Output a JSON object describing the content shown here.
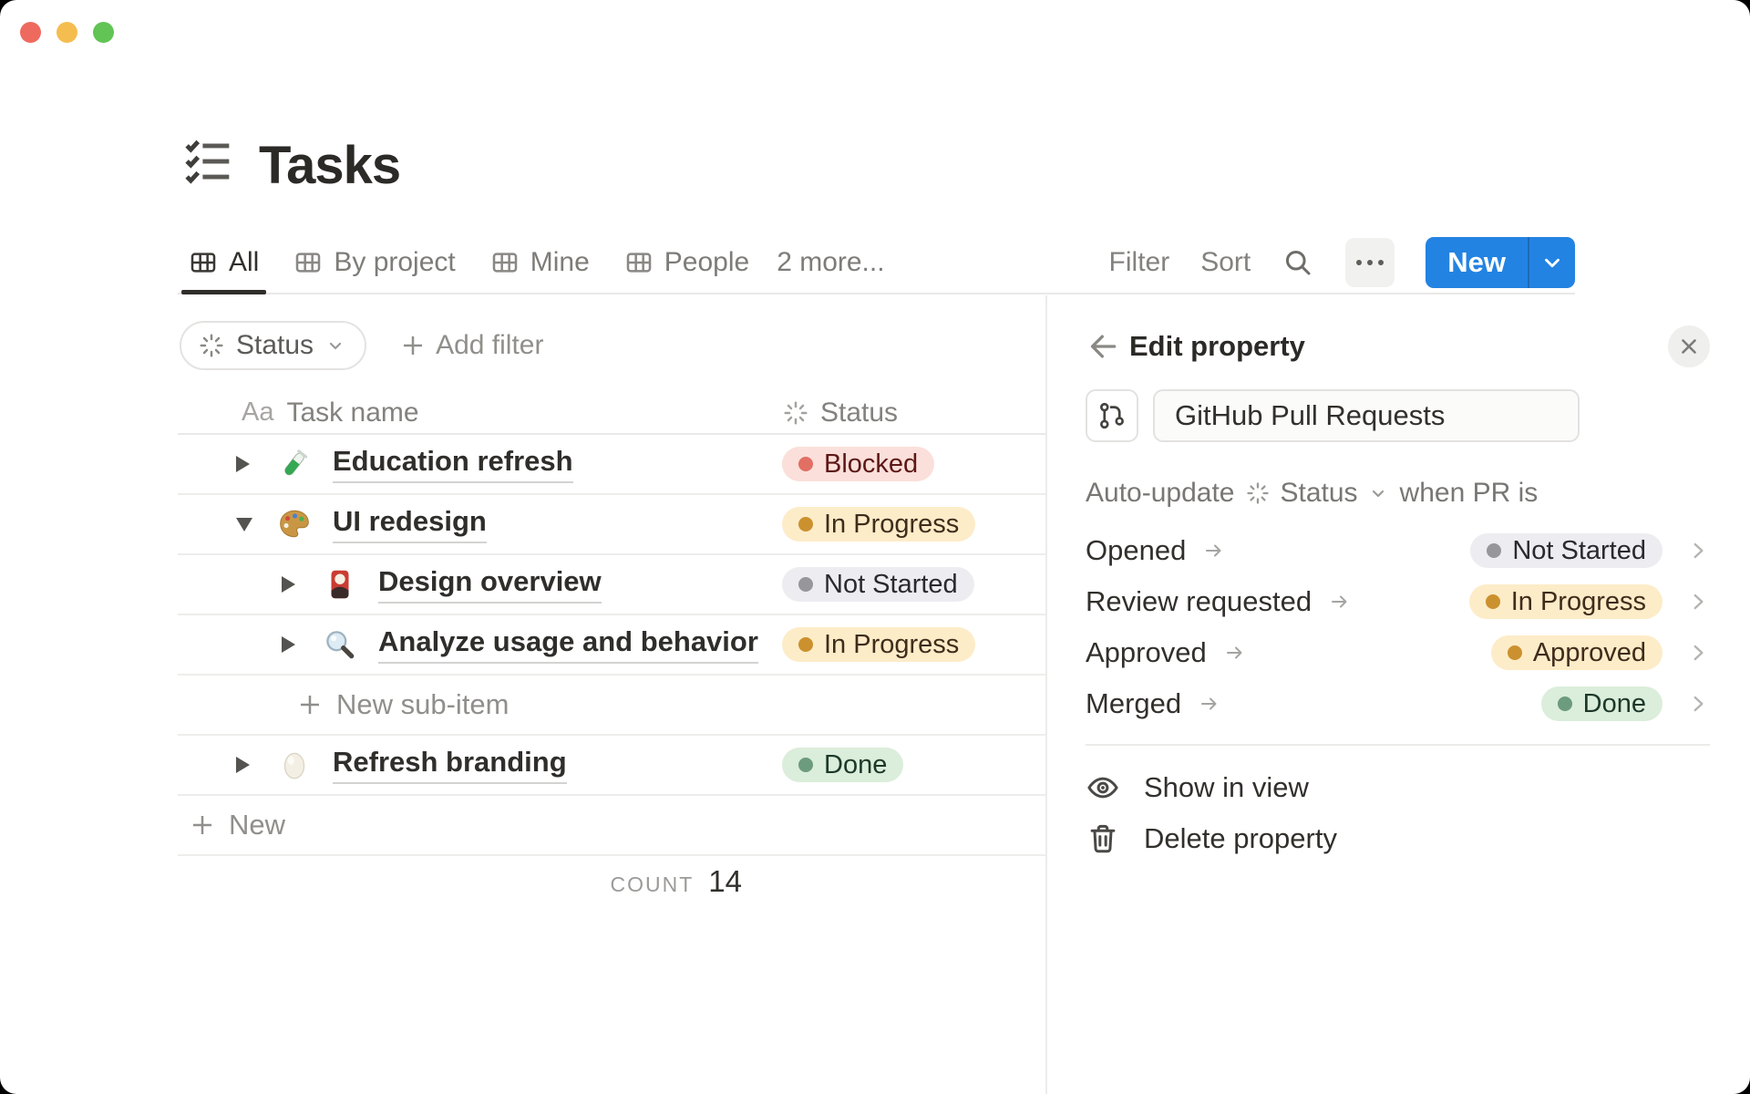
{
  "window": {
    "title": "Tasks",
    "title_icon": "checklist-icon",
    "count_visible_rows": 7
  },
  "tabs": {
    "items": [
      {
        "label": "All",
        "icon": "table-view-icon",
        "active": true
      },
      {
        "label": "By project",
        "icon": "table-view-icon",
        "active": false
      },
      {
        "label": "Mine",
        "icon": "table-view-icon",
        "active": false
      },
      {
        "label": "People",
        "icon": "table-view-icon",
        "active": false
      },
      {
        "label": "2 more...",
        "icon": null,
        "active": false
      }
    ]
  },
  "toolbar": {
    "filter_label": "Filter",
    "sort_label": "Sort",
    "search_icon": "search-icon",
    "more_icon": "ellipsis-icon",
    "new_button_label": "New",
    "new_button_color": "#2383e2"
  },
  "filter_bar": {
    "status_chip": {
      "icon": "status-burst-icon",
      "label": "Status",
      "chevron": "chevron-down-icon"
    },
    "add_filter_label": "Add filter"
  },
  "table": {
    "columns": [
      {
        "icon_glyph": "Aa",
        "icon": "text-property-icon",
        "label": "Task name"
      },
      {
        "icon": "status-burst-icon",
        "label": "Status"
      }
    ],
    "rows": [
      {
        "name": "Education refresh",
        "icon": "test-tube",
        "expander": "collapsed",
        "indent": 0,
        "status": {
          "label": "Blocked",
          "variant": "red"
        }
      },
      {
        "name": "UI redesign",
        "icon": "palette",
        "expander": "expanded",
        "indent": 0,
        "status": {
          "label": "In Progress",
          "variant": "yellow"
        }
      },
      {
        "name": "Design overview",
        "icon": "flower-card",
        "expander": "collapsed",
        "indent": 1,
        "status": {
          "label": "Not Started",
          "variant": "gray"
        }
      },
      {
        "name": "Analyze usage and behavior",
        "icon": "magnifier",
        "expander": "collapsed",
        "indent": 1,
        "status": {
          "label": "In Progress",
          "variant": "yellow"
        }
      },
      {
        "name": "Refresh branding",
        "icon": "egg",
        "expander": "collapsed",
        "indent": 0,
        "status": {
          "label": "Done",
          "variant": "green"
        }
      }
    ],
    "new_sub_item_label": "New sub-item",
    "new_row_label": "New",
    "footer": {
      "count_label": "COUNT",
      "count_value": "14"
    }
  },
  "panel": {
    "back_icon": "arrow-left-icon",
    "title": "Edit property",
    "close_icon": "close-icon",
    "property": {
      "icon": "git-pull-request-icon",
      "name_value": "GitHub Pull Requests"
    },
    "auto_update": {
      "prefix": "Auto-update",
      "property_icon": "status-burst-icon",
      "property_label": "Status",
      "chevron": "chevron-down-icon",
      "suffix": "when PR is"
    },
    "mappings": [
      {
        "event": "Opened",
        "status": {
          "label": "Not Started",
          "variant": "gray"
        }
      },
      {
        "event": "Review requested",
        "status": {
          "label": "In Progress",
          "variant": "yellow"
        }
      },
      {
        "event": "Approved",
        "status": {
          "label": "Approved",
          "variant": "yellow"
        }
      },
      {
        "event": "Merged",
        "status": {
          "label": "Done",
          "variant": "green"
        }
      }
    ],
    "actions": [
      {
        "icon": "eye-icon",
        "label": "Show in view"
      },
      {
        "icon": "trash-icon",
        "label": "Delete property"
      }
    ]
  },
  "colors": {
    "accent_blue": "#2383e2",
    "pill_red_bg": "#fbdfda",
    "pill_red_text": "#5d1715",
    "pill_red_dot": "#e16f64",
    "pill_yellow_bg": "#fdecc8",
    "pill_yellow_text": "#402c1b",
    "pill_yellow_dot": "#cb912f",
    "pill_gray_bg": "#edecf1",
    "pill_gray_text": "#2a292e",
    "pill_gray_dot": "#97969b",
    "pill_green_bg": "#dbeddb",
    "pill_green_text": "#1c3829",
    "pill_green_dot": "#6c9b7d",
    "traffic_red": "#ee6a5f",
    "traffic_yellow": "#f5bd4f",
    "traffic_green": "#61c454"
  }
}
